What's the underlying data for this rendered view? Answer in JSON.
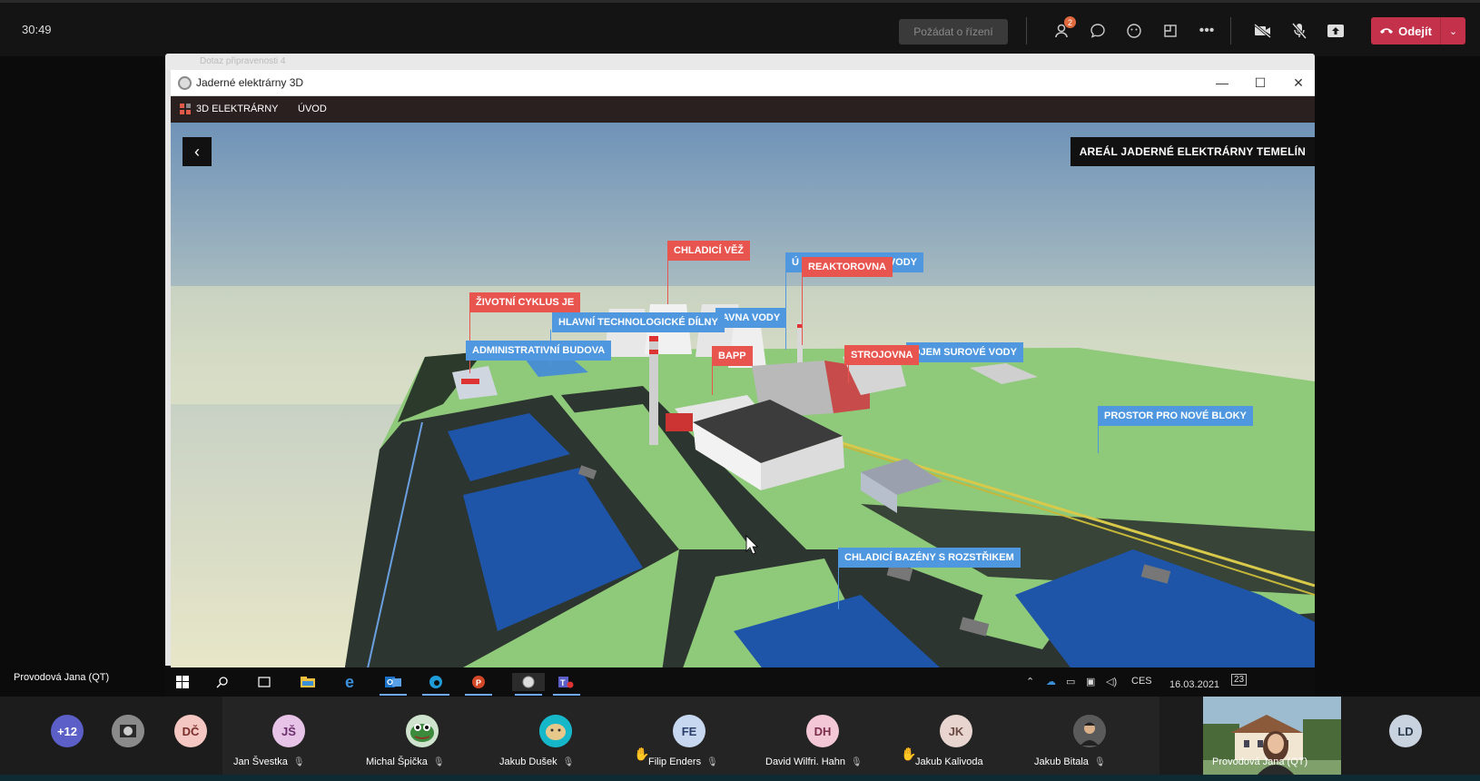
{
  "teams": {
    "call_time": "30:49",
    "request_control_label": "Požádat o řízení",
    "participants_badge": "2",
    "leave_label": "Odejít"
  },
  "background_window": {
    "tab_title": "Dotaz připravenosti 4"
  },
  "app": {
    "window_title": "Jaderné elektrárny 3D",
    "nav": [
      "3D ELEKTRÁRNY",
      "ÚVOD"
    ],
    "area_title": "AREÁL JADERNÉ ELEKTRÁRNY TEMELÍN",
    "labels": {
      "chladici_vez": "CHLADICÍ VĚŽ",
      "reaktorovna": "REAKTOROVNA",
      "uprava_vody_prefix": "Ú",
      "uprava_vody_suffix": "VODY",
      "zivotni_cyklus": "ŽIVOTNÍ CYKLUS JE",
      "hlavni_dilny": "HLAVNÍ TECHNOLOGICKÉ DÍLNY",
      "cerpaci_vody": "AVNA VODY",
      "administrativni": "ADMINISTRATIVNÍ BUDOVA",
      "bapp": "BAPP",
      "strojovna": "STROJOVNA",
      "surove_vody": "OJEM SUROVÉ VODY",
      "nove_bloky": "PROSTOR PRO NOVÉ BLOKY",
      "chladici_bazeny": "CHLADICÍ BAZÉNY S ROZSTŘIKEM"
    }
  },
  "presenter_name": "Provodová Jana (QT)",
  "windows_taskbar": {
    "language": "CES",
    "date": "16.03.2021",
    "notifications": "23"
  },
  "participants": [
    {
      "initials": "+12",
      "name": "",
      "color": "#5b5fc7"
    },
    {
      "initials": "",
      "name": "",
      "color": "#777777"
    },
    {
      "initials": "DČ",
      "name": "",
      "color": "#f4c7c3"
    },
    {
      "initials": "JŠ",
      "name": "Jan Švestka",
      "color": "#e8c3e8"
    },
    {
      "initials": "",
      "name": "Michal Špička",
      "color": "#3c7a3c"
    },
    {
      "initials": "",
      "name": "Jakub Dušek",
      "color": "#16b7c9"
    },
    {
      "initials": "FE",
      "name": "Filip Enders",
      "color": "#c7d7f0"
    },
    {
      "initials": "DH",
      "name": "David Wilfri. Hahn",
      "color": "#f4c7d6"
    },
    {
      "initials": "JK",
      "name": "Jakub Kalivoda",
      "color": "#e8d5d0"
    },
    {
      "initials": "",
      "name": "Jakub Bitala",
      "color": "#444444"
    },
    {
      "initials": "",
      "name": "Provodová Jana (QT)",
      "color": "#6a8a4a"
    },
    {
      "initials": "LD",
      "name": "",
      "color": "#c9d3e0"
    }
  ]
}
